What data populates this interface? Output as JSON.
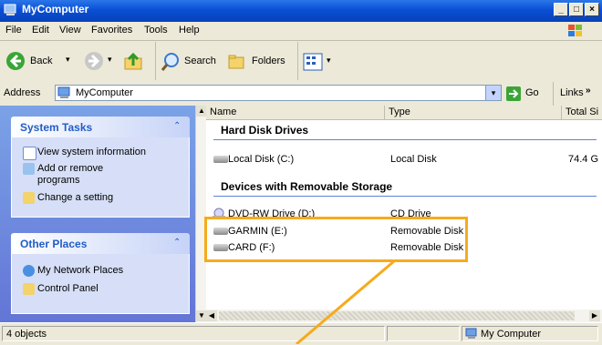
{
  "window": {
    "title": "MyComputer"
  },
  "menu": [
    "File",
    "Edit",
    "View",
    "Favorites",
    "Tools",
    "Help"
  ],
  "toolbar": {
    "back": "Back",
    "search": "Search",
    "folders": "Folders"
  },
  "address": {
    "label": "Address",
    "value": "MyComputer",
    "go": "Go",
    "links": "Links"
  },
  "system_tasks": {
    "title": "System Tasks",
    "items": [
      "View system information",
      "Add or remove programs",
      "Change a setting"
    ]
  },
  "other_places": {
    "title": "Other Places",
    "items": [
      "My Network Places",
      "Control Panel"
    ]
  },
  "columns": [
    "Name",
    "Type",
    "Total Si"
  ],
  "groups": [
    {
      "title": "Hard Disk Drives",
      "rows": [
        {
          "name": "Local Disk (C:)",
          "type": "Local Disk",
          "size": "74.4 G"
        }
      ]
    },
    {
      "title": "Devices with Removable Storage",
      "rows": [
        {
          "name": "DVD-RW Drive (D:)",
          "type": "CD Drive",
          "size": ""
        },
        {
          "name": "GARMIN (E:)",
          "type": "Removable Disk",
          "size": ""
        },
        {
          "name": "CARD (F:)",
          "type": "Removable Disk",
          "size": ""
        }
      ]
    }
  ],
  "status": {
    "count": "4 objects",
    "location": "My Computer"
  },
  "colors": {
    "highlight": "#f6ab1c",
    "title_blue": "#0a4fd6",
    "link_blue": "#215dc6"
  }
}
